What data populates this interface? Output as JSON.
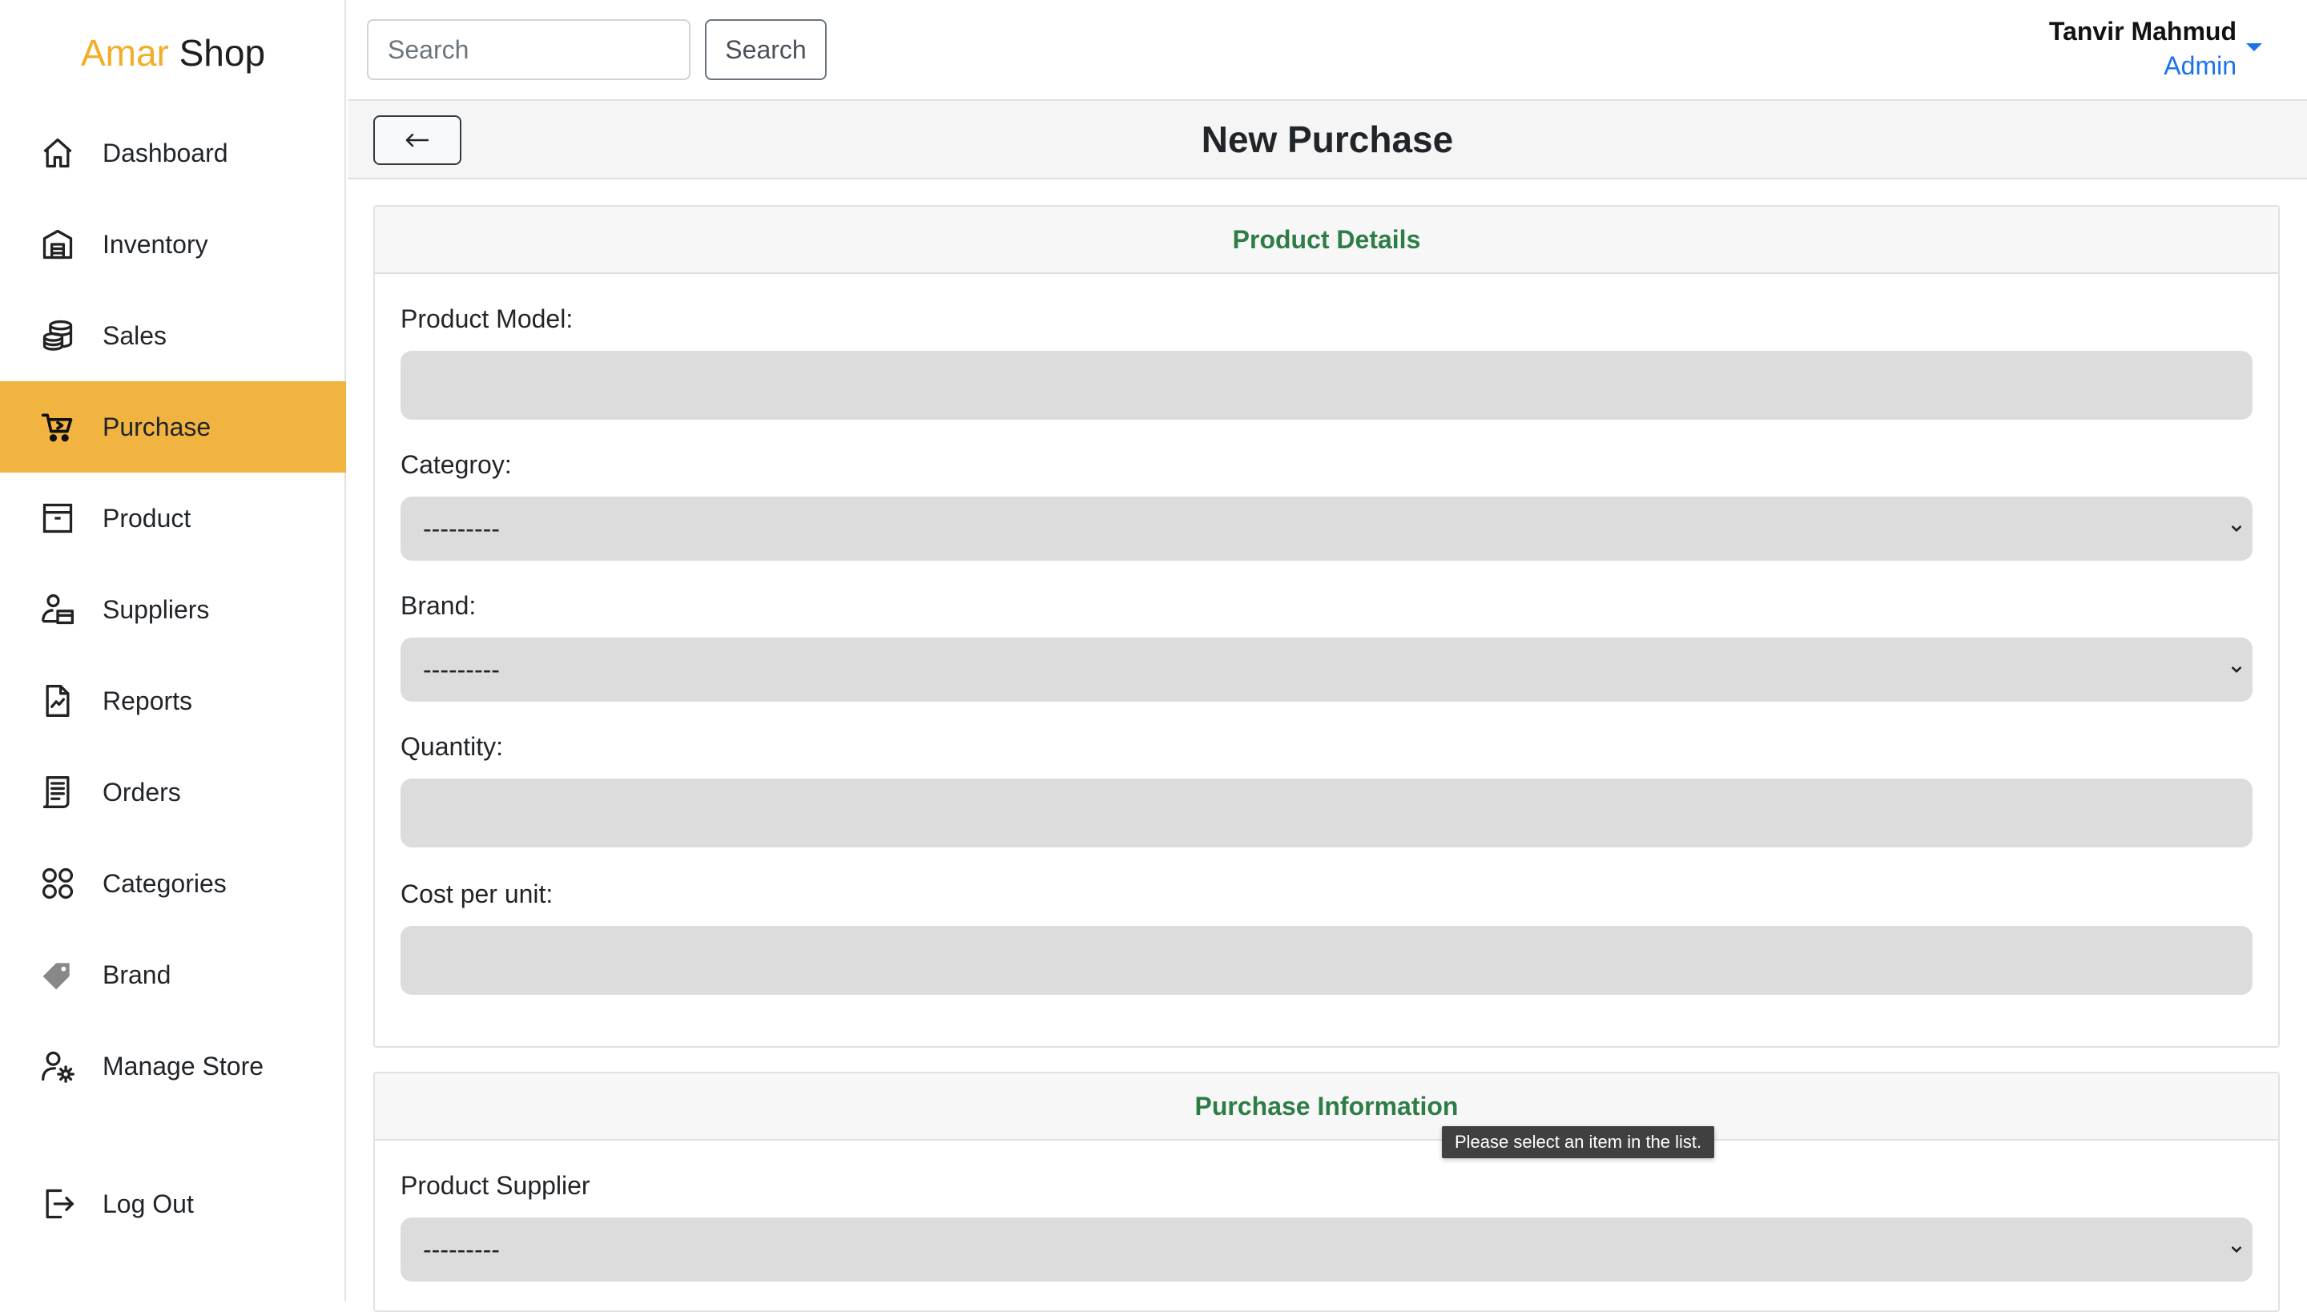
{
  "app": {
    "logo_part1": "Amar",
    "logo_part2": "Shop"
  },
  "sidebar": {
    "items": [
      {
        "label": "Dashboard",
        "icon": "house-icon"
      },
      {
        "label": "Inventory",
        "icon": "warehouse-icon"
      },
      {
        "label": "Sales",
        "icon": "coins-icon"
      },
      {
        "label": "Purchase",
        "icon": "cart-icon",
        "active": true
      },
      {
        "label": "Product",
        "icon": "archive-box-icon"
      },
      {
        "label": "Suppliers",
        "icon": "supplier-icon"
      },
      {
        "label": "Reports",
        "icon": "report-file-icon"
      },
      {
        "label": "Orders",
        "icon": "receipt-icon"
      },
      {
        "label": "Categories",
        "icon": "shapes-icon"
      },
      {
        "label": "Brand",
        "icon": "tag-icon"
      },
      {
        "label": "Manage Store",
        "icon": "user-gear-icon"
      }
    ],
    "logout": {
      "label": "Log Out",
      "icon": "logout-icon"
    },
    "active_color": "#f2b441"
  },
  "header": {
    "search_placeholder": "Search",
    "search_button": "Search",
    "user_name": "Tanvir Mahmud",
    "user_role": "Admin"
  },
  "page": {
    "title": "New Purchase",
    "back_icon": "arrow-left-icon"
  },
  "product_details": {
    "title": "Product Details",
    "model_label": "Product Model:",
    "model_value": "",
    "category_label": "Categroy:",
    "category_selected": "---------",
    "brand_label": "Brand:",
    "brand_selected": "---------",
    "quantity_label": "Quantity:",
    "quantity_value": "",
    "cost_label": "Cost per unit:",
    "cost_value": ""
  },
  "purchase_info": {
    "title": "Purchase Information",
    "supplier_label": "Product Supplier",
    "supplier_selected": "---------"
  },
  "tooltip": {
    "text": "Please select an item in the list."
  },
  "colors": {
    "accent": "#f2b441",
    "section_title": "#2f7d46",
    "role_link": "#1a73e8",
    "field_bg": "#dcdcdc"
  }
}
